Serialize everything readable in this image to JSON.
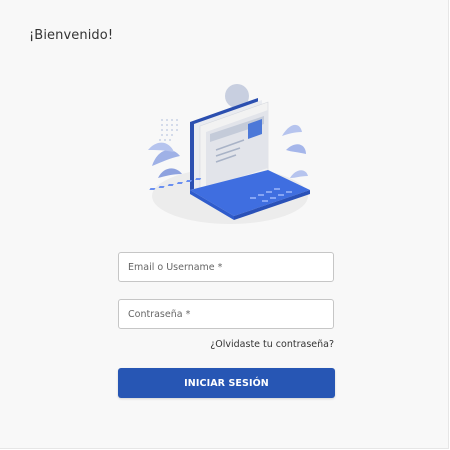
{
  "header": {
    "welcome_text": "¡Bienvenido!"
  },
  "illustration": {
    "icon": "laptop-with-documents-icon"
  },
  "form": {
    "email_placeholder": "Email o Username *",
    "email_value": "",
    "password_placeholder": "Contraseña *",
    "password_value": "",
    "forgot_link": "¿Olvidaste tu contraseña?",
    "submit_label": "INICIAR SESIÓN"
  },
  "colors": {
    "background": "#f8f8f8",
    "accent": "#2756b4",
    "laptop_blue": "#3f6ee0",
    "text": "#333333"
  }
}
